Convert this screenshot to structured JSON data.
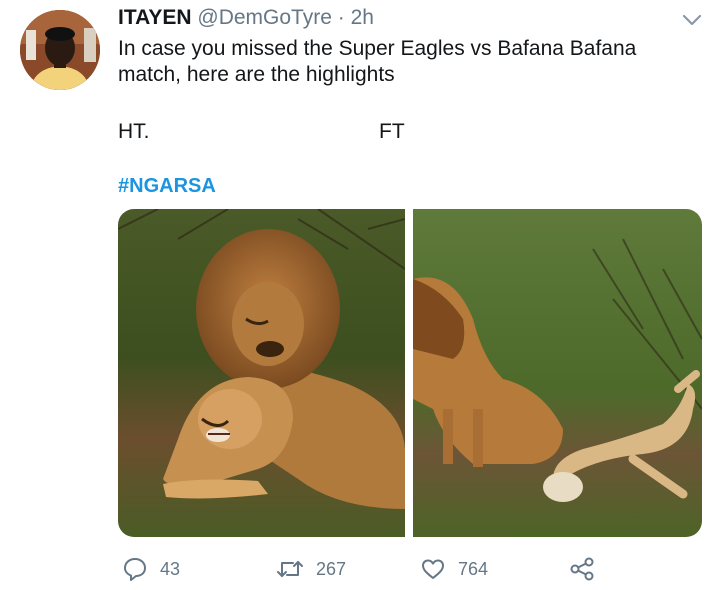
{
  "tweet": {
    "display_name": "ITAYEN",
    "handle": "@DemGoTyre",
    "separator": "·",
    "time": "2h",
    "text_line1": "In case you missed the Super Eagles vs Bafana Bafana",
    "text_line2": "match, here are the highlights",
    "label_ht": "HT.",
    "label_ft": "FT",
    "hashtag": "#NGARSA"
  },
  "media": {
    "left_image": "lion-and-lioness-halftime-photo",
    "right_image": "lion-and-lioness-fulltime-photo"
  },
  "actions": {
    "reply_count": "43",
    "retweet_count": "267",
    "like_count": "764"
  },
  "icons": {
    "menu": "chevron-down-icon",
    "reply": "speech-bubble-icon",
    "retweet": "retweet-icon",
    "like": "heart-icon",
    "share": "share-icon"
  },
  "colors": {
    "text": "#14171a",
    "secondary": "#657786",
    "link": "#1b95e0"
  }
}
